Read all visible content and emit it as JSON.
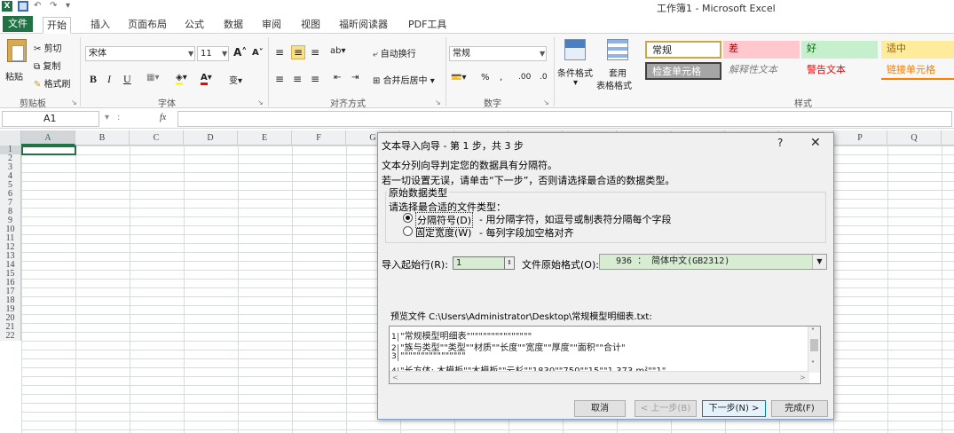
{
  "window_title": "工作簿1 - Microsoft Excel",
  "tabs": [
    "文件",
    "开始",
    "插入",
    "页面布局",
    "公式",
    "数据",
    "审阅",
    "视图",
    "福昕阅读器",
    "PDF工具"
  ],
  "ribbon": {
    "clipboard": {
      "paste": "粘贴",
      "cut": "剪切",
      "copy": "复制",
      "format_painter": "格式刷",
      "label": "剪贴板"
    },
    "font": {
      "name": "宋体",
      "size": "11",
      "label": "字体",
      "bold": "B",
      "italic": "I",
      "underline": "U"
    },
    "alignment": {
      "wrap": "自动换行",
      "merge": "合并后居中",
      "label": "对齐方式"
    },
    "number": {
      "format": "常规",
      "label": "数字",
      "percent": "%",
      "comma": ",",
      "inc_dec": ".00",
      "dec_dec": ".0"
    },
    "styles_btns": {
      "conditional": "条件格式",
      "table": "套用",
      "table2": "表格格式",
      "label": "样式"
    },
    "cell_styles": {
      "normal": "常规",
      "bad": "差",
      "good": "好",
      "neutral": "适中",
      "check": "检查单元格",
      "explanatory": "解释性文本",
      "warning": "警告文本",
      "linked": "链接单元格"
    }
  },
  "formula_bar": {
    "name_box": "A1",
    "fx": "fx",
    "value": ""
  },
  "columns": [
    "A",
    "B",
    "C",
    "D",
    "E",
    "F",
    "G",
    "H",
    "I",
    "J",
    "K",
    "L",
    "M",
    "N",
    "O",
    "P",
    "Q"
  ],
  "rows": [
    "1",
    "2",
    "3",
    "4",
    "5",
    "6",
    "7",
    "8",
    "9",
    "10",
    "11",
    "12",
    "13",
    "14",
    "15",
    "16",
    "17",
    "18",
    "19",
    "20",
    "21",
    "22"
  ],
  "dialog": {
    "title": "文本导入向导 - 第 1 步，共 3 步",
    "help": "?",
    "close": "✕",
    "line1": "文本分列向导判定您的数据具有分隔符。",
    "line2": "若一切设置无误，请单击“下一步”，否则请选择最合适的数据类型。",
    "group_title": "原始数据类型",
    "choose": "请选择最合适的文件类型：",
    "opt_delim": "分隔符号(D)",
    "opt_delim_desc": "- 用分隔字符，如逗号或制表符分隔每个字段",
    "opt_fixed": "固定宽度(W)",
    "opt_fixed_desc": "- 每列字段加空格对齐",
    "start_row_label": "导入起始行(R):",
    "start_row_value": "1",
    "origin_label": "文件原始格式(O):",
    "origin_value": "936 ： 简体中文(GB2312)",
    "preview_label": "预览文件 C:\\Users\\Administrator\\Desktop\\常规模型明细表.txt:",
    "preview_lines": [
      {
        "num": "1",
        "text": "\"常规模型明细表\"\"\"\"\"\"\"\"\"\"\"\"\"\"\"\""
      },
      {
        "num": "2",
        "text": "\"族与类型\"\"类型\"\"材质\"\"长度\"\"宽度\"\"厚度\"\"面积\"\"合计\""
      },
      {
        "num": "3",
        "text": "\"\"\"\"\"\"\"\"\"\"\"\"\"\"\"\""
      },
      {
        "num": "4",
        "text": "\"长方体: 木模板\"\"木模板\"\"云杉\"\"1830\"\"750\"\"15\"\"1.373 m²\"\"1\""
      }
    ],
    "buttons": {
      "cancel": "取消",
      "back": "< 上一步(B)",
      "next": "下一步(N) >",
      "finish": "完成(F)"
    }
  }
}
